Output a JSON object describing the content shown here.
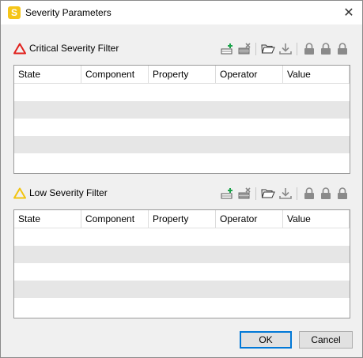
{
  "window": {
    "title": "Severity Parameters",
    "icon_letter": "S",
    "close_glyph": "✕"
  },
  "sections": [
    {
      "label": "Critical Severity Filter",
      "icon": "warning-triangle-icon",
      "icon_color": "#e0201c",
      "columns": [
        "State",
        "Component",
        "Property",
        "Operator",
        "Value"
      ]
    },
    {
      "label": "Low Severity Filter",
      "icon": "warning-triangle-icon",
      "icon_color": "#f2c40f",
      "columns": [
        "State",
        "Component",
        "Property",
        "Operator",
        "Value"
      ]
    }
  ],
  "toolbar_icons": [
    "add-row-icon",
    "delete-row-icon",
    "open-folder-icon",
    "download-icon",
    "lock-icon",
    "lock-icon",
    "lock-icon"
  ],
  "buttons": {
    "ok": "OK",
    "cancel": "Cancel"
  },
  "colors": {
    "accent": "#0078d7",
    "alt_row": "#e6e6e6",
    "critical": "#e0201c",
    "low": "#f2c40f"
  }
}
